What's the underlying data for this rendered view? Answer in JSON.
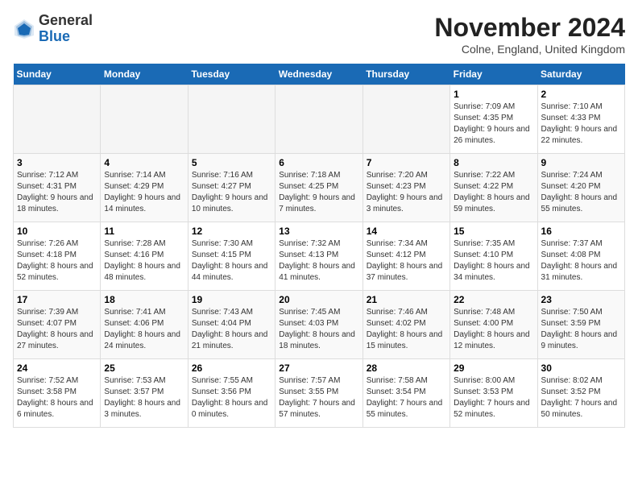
{
  "logo": {
    "general": "General",
    "blue": "Blue"
  },
  "header": {
    "month": "November 2024",
    "location": "Colne, England, United Kingdom"
  },
  "days_of_week": [
    "Sunday",
    "Monday",
    "Tuesday",
    "Wednesday",
    "Thursday",
    "Friday",
    "Saturday"
  ],
  "weeks": [
    [
      {
        "day": "",
        "info": ""
      },
      {
        "day": "",
        "info": ""
      },
      {
        "day": "",
        "info": ""
      },
      {
        "day": "",
        "info": ""
      },
      {
        "day": "",
        "info": ""
      },
      {
        "day": "1",
        "info": "Sunrise: 7:09 AM\nSunset: 4:35 PM\nDaylight: 9 hours and 26 minutes."
      },
      {
        "day": "2",
        "info": "Sunrise: 7:10 AM\nSunset: 4:33 PM\nDaylight: 9 hours and 22 minutes."
      }
    ],
    [
      {
        "day": "3",
        "info": "Sunrise: 7:12 AM\nSunset: 4:31 PM\nDaylight: 9 hours and 18 minutes."
      },
      {
        "day": "4",
        "info": "Sunrise: 7:14 AM\nSunset: 4:29 PM\nDaylight: 9 hours and 14 minutes."
      },
      {
        "day": "5",
        "info": "Sunrise: 7:16 AM\nSunset: 4:27 PM\nDaylight: 9 hours and 10 minutes."
      },
      {
        "day": "6",
        "info": "Sunrise: 7:18 AM\nSunset: 4:25 PM\nDaylight: 9 hours and 7 minutes."
      },
      {
        "day": "7",
        "info": "Sunrise: 7:20 AM\nSunset: 4:23 PM\nDaylight: 9 hours and 3 minutes."
      },
      {
        "day": "8",
        "info": "Sunrise: 7:22 AM\nSunset: 4:22 PM\nDaylight: 8 hours and 59 minutes."
      },
      {
        "day": "9",
        "info": "Sunrise: 7:24 AM\nSunset: 4:20 PM\nDaylight: 8 hours and 55 minutes."
      }
    ],
    [
      {
        "day": "10",
        "info": "Sunrise: 7:26 AM\nSunset: 4:18 PM\nDaylight: 8 hours and 52 minutes."
      },
      {
        "day": "11",
        "info": "Sunrise: 7:28 AM\nSunset: 4:16 PM\nDaylight: 8 hours and 48 minutes."
      },
      {
        "day": "12",
        "info": "Sunrise: 7:30 AM\nSunset: 4:15 PM\nDaylight: 8 hours and 44 minutes."
      },
      {
        "day": "13",
        "info": "Sunrise: 7:32 AM\nSunset: 4:13 PM\nDaylight: 8 hours and 41 minutes."
      },
      {
        "day": "14",
        "info": "Sunrise: 7:34 AM\nSunset: 4:12 PM\nDaylight: 8 hours and 37 minutes."
      },
      {
        "day": "15",
        "info": "Sunrise: 7:35 AM\nSunset: 4:10 PM\nDaylight: 8 hours and 34 minutes."
      },
      {
        "day": "16",
        "info": "Sunrise: 7:37 AM\nSunset: 4:08 PM\nDaylight: 8 hours and 31 minutes."
      }
    ],
    [
      {
        "day": "17",
        "info": "Sunrise: 7:39 AM\nSunset: 4:07 PM\nDaylight: 8 hours and 27 minutes."
      },
      {
        "day": "18",
        "info": "Sunrise: 7:41 AM\nSunset: 4:06 PM\nDaylight: 8 hours and 24 minutes."
      },
      {
        "day": "19",
        "info": "Sunrise: 7:43 AM\nSunset: 4:04 PM\nDaylight: 8 hours and 21 minutes."
      },
      {
        "day": "20",
        "info": "Sunrise: 7:45 AM\nSunset: 4:03 PM\nDaylight: 8 hours and 18 minutes."
      },
      {
        "day": "21",
        "info": "Sunrise: 7:46 AM\nSunset: 4:02 PM\nDaylight: 8 hours and 15 minutes."
      },
      {
        "day": "22",
        "info": "Sunrise: 7:48 AM\nSunset: 4:00 PM\nDaylight: 8 hours and 12 minutes."
      },
      {
        "day": "23",
        "info": "Sunrise: 7:50 AM\nSunset: 3:59 PM\nDaylight: 8 hours and 9 minutes."
      }
    ],
    [
      {
        "day": "24",
        "info": "Sunrise: 7:52 AM\nSunset: 3:58 PM\nDaylight: 8 hours and 6 minutes."
      },
      {
        "day": "25",
        "info": "Sunrise: 7:53 AM\nSunset: 3:57 PM\nDaylight: 8 hours and 3 minutes."
      },
      {
        "day": "26",
        "info": "Sunrise: 7:55 AM\nSunset: 3:56 PM\nDaylight: 8 hours and 0 minutes."
      },
      {
        "day": "27",
        "info": "Sunrise: 7:57 AM\nSunset: 3:55 PM\nDaylight: 7 hours and 57 minutes."
      },
      {
        "day": "28",
        "info": "Sunrise: 7:58 AM\nSunset: 3:54 PM\nDaylight: 7 hours and 55 minutes."
      },
      {
        "day": "29",
        "info": "Sunrise: 8:00 AM\nSunset: 3:53 PM\nDaylight: 7 hours and 52 minutes."
      },
      {
        "day": "30",
        "info": "Sunrise: 8:02 AM\nSunset: 3:52 PM\nDaylight: 7 hours and 50 minutes."
      }
    ]
  ]
}
